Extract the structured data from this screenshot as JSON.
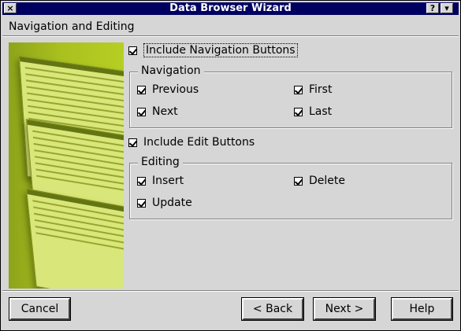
{
  "window": {
    "title": "Data Browser Wizard",
    "close_glyph": "×",
    "help_glyph": "?",
    "menu_glyph": "▾"
  },
  "page": {
    "header": "Navigation and Editing"
  },
  "include_navigation": {
    "label": "Include Navigation Buttons",
    "checked": true
  },
  "navigation_group": {
    "title": "Navigation",
    "items": [
      {
        "label": "Previous",
        "checked": true
      },
      {
        "label": "First",
        "checked": true
      },
      {
        "label": "Next",
        "checked": true
      },
      {
        "label": "Last",
        "checked": true
      }
    ]
  },
  "include_edit": {
    "label": "Include Edit Buttons",
    "checked": true
  },
  "editing_group": {
    "title": "Editing",
    "items": [
      {
        "label": "Insert",
        "checked": true
      },
      {
        "label": "Delete",
        "checked": true
      },
      {
        "label": "Update",
        "checked": true
      }
    ]
  },
  "buttons": {
    "cancel": "Cancel",
    "back": "< Back",
    "next": "Next >",
    "help": "Help"
  },
  "colors": {
    "titlebar": "#000060",
    "illustration": "#a9c01f",
    "dialog_bg": "#d6d6d6"
  }
}
